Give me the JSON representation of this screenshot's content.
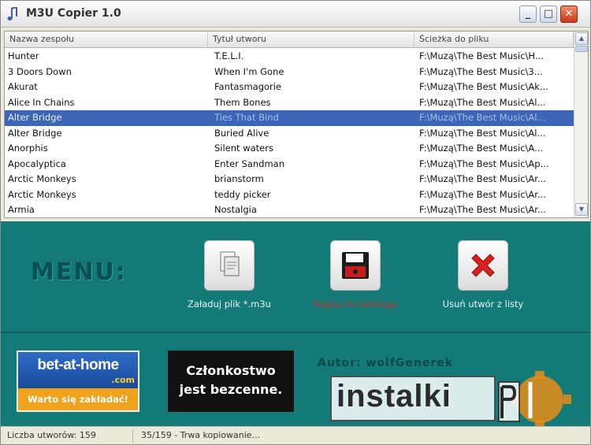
{
  "window": {
    "title": "M3U Copier 1.0",
    "controls": {
      "minimize": "_",
      "maximize": "□",
      "close": "✕"
    }
  },
  "list": {
    "columns": [
      "Nazwa zespołu",
      "Tytuł utworu",
      "Ścieżka do pliku"
    ],
    "rows": [
      {
        "band": "Hunter",
        "title": "T.E.L.I.",
        "path": "F:\\Muzą\\The Best Music\\H..."
      },
      {
        "band": "3 Doors Down",
        "title": "When I'm Gone",
        "path": "F:\\Muzą\\The Best Music\\3..."
      },
      {
        "band": "Akurat",
        "title": "Fantasmagorie",
        "path": "F:\\Muzą\\The Best Music\\Ak..."
      },
      {
        "band": "Alice In Chains",
        "title": "Them Bones",
        "path": "F:\\Muzą\\The Best Music\\Al..."
      },
      {
        "band": "Alter Bridge",
        "title": "Ties That Bind",
        "path": "F:\\Muzą\\The Best Music\\Al...",
        "selected": true
      },
      {
        "band": "Alter Bridge",
        "title": "Buried Alive",
        "path": "F:\\Muzą\\The Best Music\\Al..."
      },
      {
        "band": "Anorphis",
        "title": "Silent waters",
        "path": "F:\\Muzą\\The Best Music\\A..."
      },
      {
        "band": "Apocalyptica",
        "title": "Enter Sandman",
        "path": "F:\\Muzą\\The Best Music\\Ap..."
      },
      {
        "band": "Arctic Monkeys",
        "title": "brianstorm",
        "path": "F:\\Muzą\\The Best Music\\Ar..."
      },
      {
        "band": "Arctic Monkeys",
        "title": "teddy picker",
        "path": "F:\\Muzą\\The Best Music\\Ar..."
      },
      {
        "band": "Armia",
        "title": "Nostalgia",
        "path": "F:\\Muzą\\The Best Music\\Ar..."
      }
    ]
  },
  "menu": {
    "label": "MENU:",
    "load_label": "Załaduj plik *.m3u",
    "save_label": "Kopiuj do katalogu",
    "remove_label": "Usuń utwór z listy"
  },
  "ads": {
    "bet_logo": "bet-at-home",
    "bet_com": ".com",
    "bet_slogan": "Warto się zakładać!",
    "member_line1": "Członkostwo",
    "member_line2": "jest bezcenne.",
    "blurred_text": "Autor: wolfGenerek",
    "watermark": "instalki"
  },
  "status": {
    "count": "Liczba utworów: 159",
    "progress": "35/159 - Trwa kopiowanie..."
  },
  "colors": {
    "panel": "#147a78",
    "selection": "#3b66b8",
    "save_caption": "#b8322d"
  }
}
